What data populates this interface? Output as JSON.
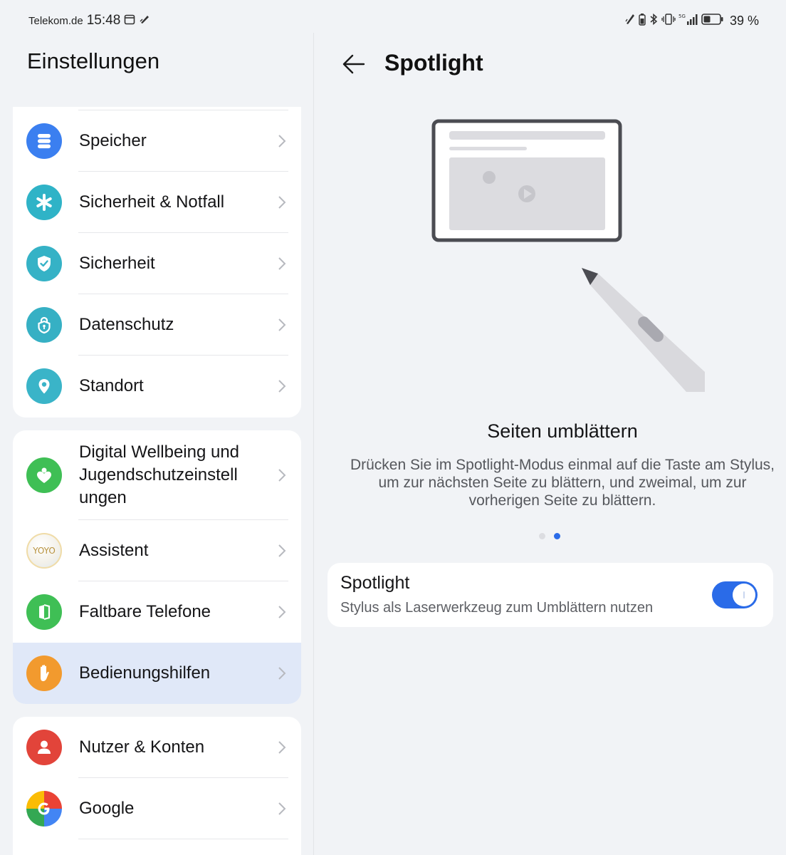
{
  "status_bar": {
    "carrier": "Telekom.de",
    "time": "15:48",
    "battery_text": "39 %",
    "network": "5G"
  },
  "left_pane": {
    "title": "Einstellungen",
    "groups": [
      {
        "items": [
          {
            "label": "Speicher",
            "icon": "storage-icon",
            "color": "#3b7ff0"
          },
          {
            "label": "Sicherheit & Notfall",
            "icon": "asterisk-icon",
            "color": "#2fb3c7"
          },
          {
            "label": "Sicherheit",
            "icon": "shield-icon",
            "color": "#35b2c6"
          },
          {
            "label": "Datenschutz",
            "icon": "privacy-lock-icon",
            "color": "#36b0c4"
          },
          {
            "label": "Standort",
            "icon": "location-pin-icon",
            "color": "#3ab4c8"
          }
        ]
      },
      {
        "items": [
          {
            "label": "Digital Wellbeing und Jugendschutzeinstell ungen",
            "icon": "wellbeing-heart-icon",
            "color": "#3fbf55"
          },
          {
            "label": "Assistent",
            "icon": "yoyo-icon",
            "icon_text": "YOYO",
            "color": "#c9a14a"
          },
          {
            "label": "Faltbare Telefone",
            "icon": "foldable-phone-icon",
            "color": "#3fbf55"
          },
          {
            "label": "Bedienungshilfen",
            "icon": "hand-icon",
            "color": "#f29a2e",
            "selected": true
          }
        ]
      },
      {
        "items": [
          {
            "label": "Nutzer & Konten",
            "icon": "user-icon",
            "color": "#e2443a"
          },
          {
            "label": "Google",
            "icon": "google-icon",
            "color": "#4285f4"
          }
        ]
      }
    ]
  },
  "right_pane": {
    "title": "Spotlight",
    "slide_title": "Seiten umblättern",
    "slide_description": "Drücken Sie im Spotlight-Modus einmal auf die Taste am Stylus, um zur nächsten Seite zu blättern, und zweimal, um zur vorherigen Seite zu blättern.",
    "pager": {
      "count": 2,
      "active_index": 1
    },
    "toggle_card": {
      "title": "Spotlight",
      "subtitle": "Stylus als Laserwerkzeug zum Umblättern nutzen",
      "enabled": true
    }
  },
  "colors": {
    "accent": "#2a6be8",
    "background": "#f1f3f6",
    "selected_row": "#e0e8f8"
  }
}
